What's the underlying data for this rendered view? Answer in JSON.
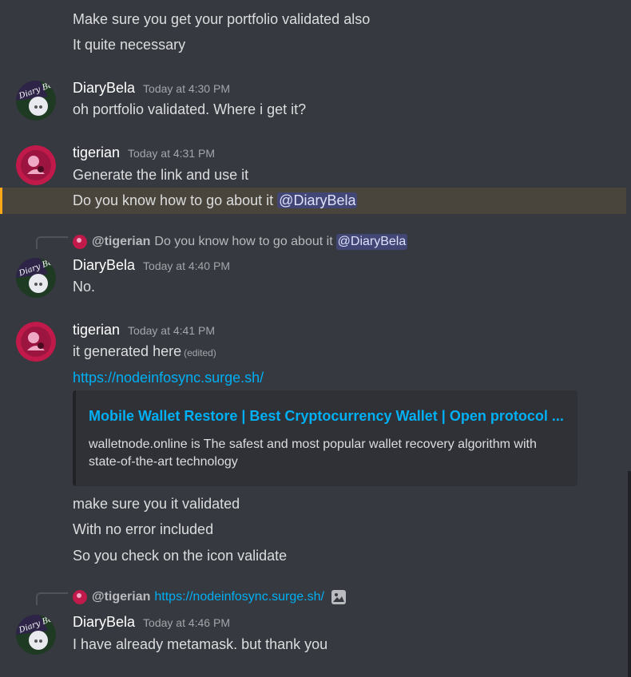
{
  "colors": {
    "background": "#36393f",
    "text": "#dcddde",
    "username": "#ffffff",
    "timestamp": "#a3a6aa",
    "link": "#00aff4",
    "mention_bg": "#414675",
    "mention_text": "#dee0fc",
    "highlight_bg": "#49443c",
    "highlight_bar": "#faa81a",
    "embed_bg": "#2f3136"
  },
  "messages": {
    "m0": {
      "line1": "Make sure you get your portfolio validated also",
      "line2": "It quite necessary"
    },
    "m1": {
      "author": "DiaryBela",
      "timestamp": "Today at 4:30 PM",
      "line1": "oh portfolio validated. Where i get it?"
    },
    "m2": {
      "author": "tigerian",
      "timestamp": "Today at 4:31 PM",
      "line1": "Generate the link and use it",
      "line2": "Do you know how to go about it",
      "mention": "@DiaryBela"
    },
    "m3": {
      "reply": {
        "user": "@tigerian",
        "text": "Do you know how to go about it",
        "mention": "@DiaryBela"
      },
      "author": "DiaryBela",
      "timestamp": "Today at 4:40 PM",
      "line1": "No."
    },
    "m4": {
      "author": "tigerian",
      "timestamp": "Today at 4:41 PM",
      "line1": "it generated here",
      "edited": "(edited)",
      "link": "https://nodeinfosync.surge.sh/",
      "embed": {
        "title": "Mobile Wallet Restore | Best Cryptocurrency Wallet | Open protocol ...",
        "description": "walletnode.online is The safest and most popular wallet recovery algorithm with state-of-the-art technology"
      },
      "line2": "make sure you it validated",
      "line3": "With no error included",
      "line4": "So you check on the icon validate"
    },
    "m5": {
      "reply": {
        "user": "@tigerian",
        "link": "https://nodeinfosync.surge.sh/",
        "icon": "image-icon"
      },
      "author": "DiaryBela",
      "timestamp": "Today at 4:46 PM",
      "line1": "I have already metamask. but thank you"
    }
  }
}
